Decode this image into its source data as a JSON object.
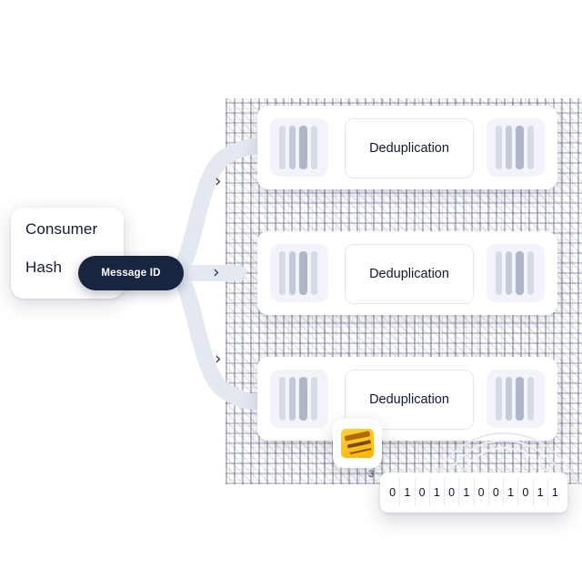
{
  "diagram": {
    "title": "Consumer hash message-ID deduplication flow",
    "background": "#ffffff",
    "accent_dark": "#17253f",
    "accent_yellow": "#ffc400"
  },
  "consumer": {
    "title": "Consumer",
    "subtitle": "Hash",
    "pill_label": "Message ID"
  },
  "chevrons": [
    {
      "glyph": "›",
      "name": "chevron-right-icon-top"
    },
    {
      "glyph": "›",
      "name": "chevron-right-icon-middle"
    },
    {
      "glyph": "›",
      "name": "chevron-right-icon-bottom"
    }
  ],
  "rows": [
    {
      "label": "Deduplication"
    },
    {
      "label": "Deduplication"
    },
    {
      "label": "Deduplication"
    }
  ],
  "binary_strip": {
    "bits": [
      "0",
      "1",
      "0",
      "1",
      "0",
      "1",
      "0",
      "0",
      "1",
      "0",
      "1",
      "1"
    ]
  },
  "stray_label": "3",
  "badge": {
    "name": "yellow-stack-badge"
  }
}
